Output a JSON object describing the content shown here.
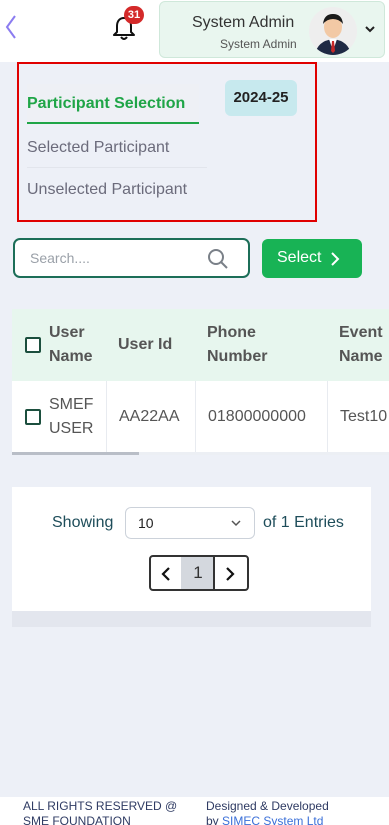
{
  "header": {
    "notifications_count": "31",
    "user_name": "System Admin",
    "user_role": "System Admin"
  },
  "tabs": [
    {
      "label": "Participant Selection",
      "active": true
    },
    {
      "label": "Selected Participant",
      "active": false
    },
    {
      "label": "Unselected Participant",
      "active": false
    }
  ],
  "year_badge": "2024-25",
  "search": {
    "placeholder": "Search...."
  },
  "select_button": "Select",
  "table": {
    "headers": [
      "User Name",
      "User Id",
      "Phone Number",
      "Event Name"
    ],
    "header_lines": [
      [
        "User",
        "Name"
      ],
      [
        "User Id"
      ],
      [
        "Phone",
        "Number"
      ],
      [
        "Event",
        "Name"
      ]
    ],
    "rows": [
      {
        "name_lines": [
          "SMEF",
          "USER"
        ],
        "user_id": "AA22AA",
        "phone": "01800000000",
        "event": "Test10"
      }
    ]
  },
  "pagination": {
    "showing_label": "Showing",
    "per_page": "10",
    "entries_label": "of 1 Entries",
    "current_page": "1"
  },
  "footer": {
    "left": [
      "ALL RIGHTS RESERVED @",
      "SME FOUNDATION"
    ],
    "right_prefix": "Designed & Developed",
    "right_by": "by",
    "right_link": "SIMEC System Ltd"
  },
  "colors": {
    "accent_green": "#18b355",
    "tab_active": "#1fa547",
    "highlight_border": "#e00000",
    "badge_red": "#d42a2a"
  },
  "icons": [
    "back-chevron-icon",
    "bell-icon",
    "chevron-down-icon",
    "search-icon",
    "chevron-right-icon",
    "chevron-left-icon",
    "checkbox-icon"
  ]
}
